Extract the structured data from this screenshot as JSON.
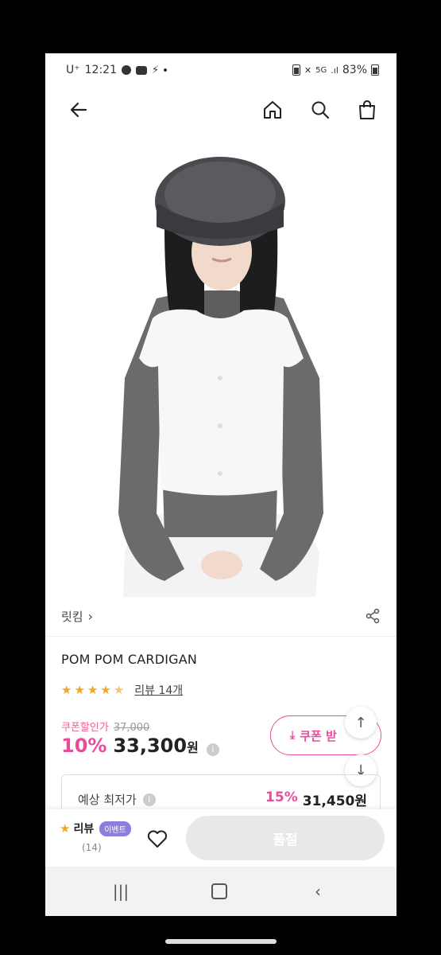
{
  "status": {
    "carrier": "U⁺",
    "time": "12:21",
    "battery": "83%"
  },
  "nav": {
    "back": "back-arrow",
    "home": "home-icon",
    "search": "search-icon",
    "bag": "shopping-bag-icon"
  },
  "product": {
    "brand": "릿킴",
    "title": "POM POM CARDIGAN",
    "rating_stars": 4.5,
    "review_link": "리뷰 14개",
    "coupon_label": "쿠폰할인가",
    "original_price": "37,000",
    "discount": "10%",
    "price": "33,300",
    "currency": "원",
    "coupon_button": "쿠폰 받",
    "best_label": "예상 최저가",
    "best_discount": "15%",
    "best_price": "31,450원"
  },
  "buybar": {
    "review_label": "리뷰",
    "event_badge": "이벤트",
    "review_count": "(14)",
    "soldout": "품절"
  },
  "colors": {
    "accent": "#e84d9b",
    "star": "#f5a623",
    "badge": "#8e7ce0"
  }
}
